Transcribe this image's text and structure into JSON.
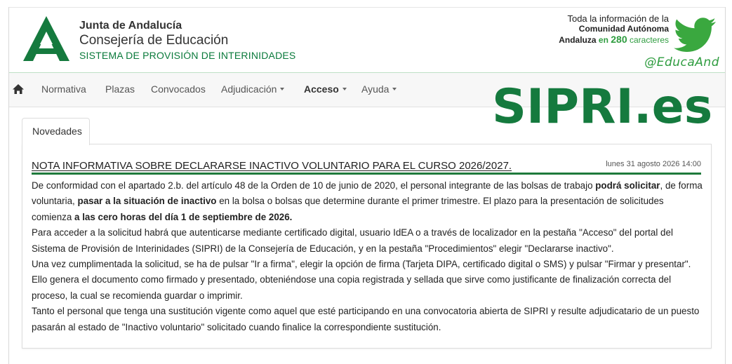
{
  "header": {
    "org_line1": "Junta de Andalucía",
    "org_line2": "Consejería de Educación",
    "org_line3": "SISTEMA DE PROVISIÓN DE INTERINIDADES",
    "twitter_line1": "Toda la información de la",
    "twitter_line2": "Comunidad Autónoma",
    "twitter_line3_a": "Andaluza",
    "twitter_line3_b": "en",
    "twitter_line3_num": "280",
    "twitter_line3_c": "caracteres",
    "twitter_handle": "@EducaAnd",
    "brand_color": "#157a3e"
  },
  "nav": {
    "home_icon": "home-icon",
    "items": [
      {
        "label": "Normativa",
        "dropdown": false
      },
      {
        "label": "Plazas",
        "dropdown": false
      },
      {
        "label": "Convocados",
        "dropdown": false
      },
      {
        "label": "Adjudicación",
        "dropdown": true
      },
      {
        "label": "Acceso",
        "dropdown": true
      },
      {
        "label": "Ayuda",
        "dropdown": true
      }
    ]
  },
  "brand_overlay": "SIPRI.es",
  "tabs": [
    {
      "label": "Novedades"
    }
  ],
  "news": {
    "title": "NOTA INFORMATIVA SOBRE DECLARARSE INACTIVO VOLUNTARIO PARA EL CURSO 2026/2027.",
    "date": "lunes 31 agosto 2026 14:00",
    "p1_a": "De conformidad con el apartado 2.b. del artículo 48 de la Orden de 10 de junio de 2020, el personal integrante de las bolsas de trabajo ",
    "p1_b": "podrá solicitar",
    "p1_c": ", de forma voluntaria, ",
    "p1_d": "pasar a la situación de inactivo",
    "p1_e": " en la bolsa o bolsas que determine durante el primer trimestre. El plazo para la presentación de solicitudes comienza ",
    "p1_f": "a las cero horas del día 1 de septiembre de 2026.",
    "p2": "Para acceder a la solicitud habrá que autenticarse mediante certificado digital, usuario IdEA o a través de localizador en la pestaña \"Acceso\" del portal del Sistema de Provisión de Interinidades (SIPRI) de la Consejería de Educación, y en la pestaña \"Procedimientos\" elegir \"Declararse inactivo\".",
    "p3": "Una vez cumplimentada la solicitud, se ha de pulsar \"Ir a firma\", elegir la opción de firma (Tarjeta DIPA, certificado digital o SMS) y pulsar \"Firmar y presentar\". Ello genera el documento como firmado y presentado, obteniéndose una copia registrada y sellada que sirve como justificante de finalización correcta del proceso, la cual se recomienda guardar o imprimir.",
    "p4": "Tanto el personal que tenga una sustitución vigente como aquel que esté participando en una convocatoria abierta de SIPRI y resulte adjudicatario de un puesto pasarán al estado de \"Inactivo voluntario\" solicitado cuando finalice la correspondiente sustitución."
  }
}
